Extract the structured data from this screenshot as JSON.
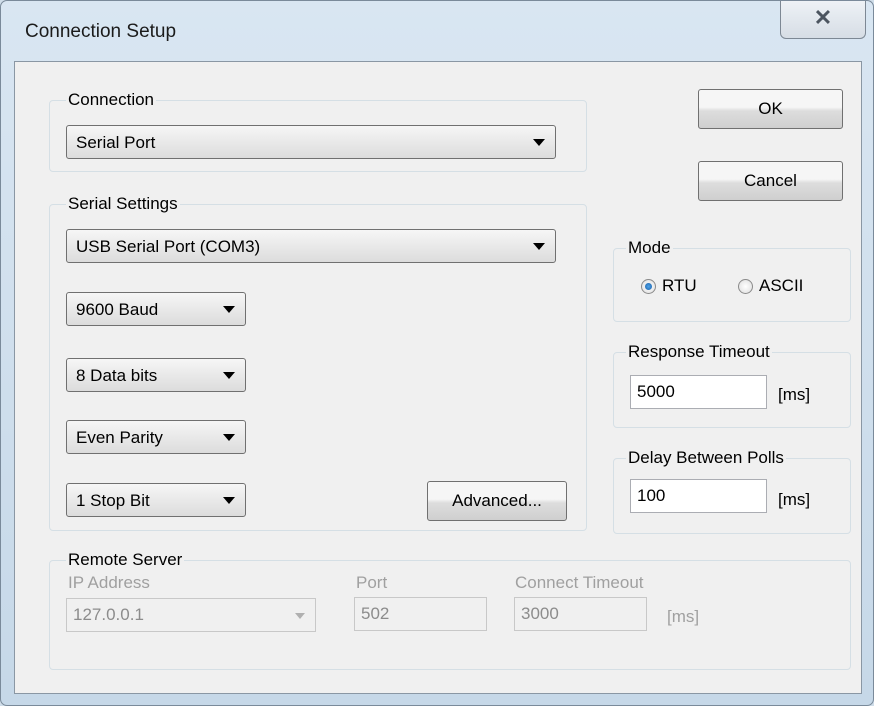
{
  "window": {
    "title": "Connection Setup",
    "close_glyph": "✕"
  },
  "connection": {
    "label": "Connection",
    "type": "Serial Port"
  },
  "serial": {
    "label": "Serial Settings",
    "port": "USB Serial Port (COM3)",
    "baud": "9600 Baud",
    "data_bits": "8 Data bits",
    "parity": "Even Parity",
    "stop_bits": "1 Stop Bit",
    "advanced_label": "Advanced..."
  },
  "buttons": {
    "ok": "OK",
    "cancel": "Cancel"
  },
  "mode": {
    "label": "Mode",
    "rtu": "RTU",
    "ascii": "ASCII",
    "selected": "RTU"
  },
  "response_timeout": {
    "label": "Response Timeout",
    "value": "5000",
    "unit": "[ms]"
  },
  "delay_polls": {
    "label": "Delay Between Polls",
    "value": "100",
    "unit": "[ms]"
  },
  "remote": {
    "label": "Remote Server",
    "ip_label": "IP Address",
    "ip_value": "127.0.0.1",
    "port_label": "Port",
    "port_value": "502",
    "timeout_label": "Connect Timeout",
    "timeout_value": "3000",
    "timeout_unit": "[ms]"
  }
}
